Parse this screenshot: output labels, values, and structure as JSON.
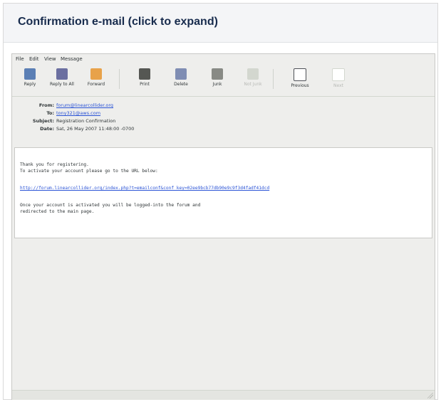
{
  "panel": {
    "title": "Confirmation e-mail (click to expand)"
  },
  "menu": [
    "File",
    "Edit",
    "View",
    "Message"
  ],
  "toolbar": [
    {
      "label": "Reply",
      "icon": "reply-icon",
      "enabled": true
    },
    {
      "label": "Reply to All",
      "icon": "reply-all-icon",
      "enabled": true
    },
    {
      "label": "Forward",
      "icon": "forward-icon",
      "enabled": true
    },
    {
      "label": "Print",
      "icon": "printer-icon",
      "enabled": true
    },
    {
      "label": "Delete",
      "icon": "trash-icon",
      "enabled": true
    },
    {
      "label": "Junk",
      "icon": "junk-icon",
      "enabled": true
    },
    {
      "label": "Not Junk",
      "icon": "not-junk-icon",
      "enabled": false
    },
    {
      "label": "Previous",
      "icon": "arrow-left-icon",
      "enabled": true
    },
    {
      "label": "Next",
      "icon": "arrow-right-icon",
      "enabled": false
    }
  ],
  "headers": {
    "from_key": "From:",
    "from": "forum@linearcollider.org",
    "to_key": "To:",
    "to": "tony321@aws.com",
    "subject_key": "Subject:",
    "subject": "Registration Confirmation",
    "date_key": "Date:",
    "date": "Sat, 26 May 2007 11:48:00 -0700"
  },
  "body": {
    "line1": "Thank you for registering.",
    "line2": "To activate your account please go to the URL below:",
    "url": "http://forum.linearcollider.org/index.php?t=emailconf&conf_key=02ee9bcb77db90e9c9f3d4fadf41dcd",
    "line3": "Once your account is activated you will be logged-into the forum and",
    "line4": "redirected to the main page."
  },
  "colors": {
    "link": "#2a53d6",
    "reply_icon": "#5b7fb5",
    "reply_all_icon": "#6b6fa0",
    "forward_icon": "#e8a24a",
    "print_icon": "#555753",
    "delete_icon": "#7f8db3",
    "junk_icon": "#888a85",
    "disabled_icon": "#d3d7cf",
    "nav_icon": "#4e5157"
  }
}
